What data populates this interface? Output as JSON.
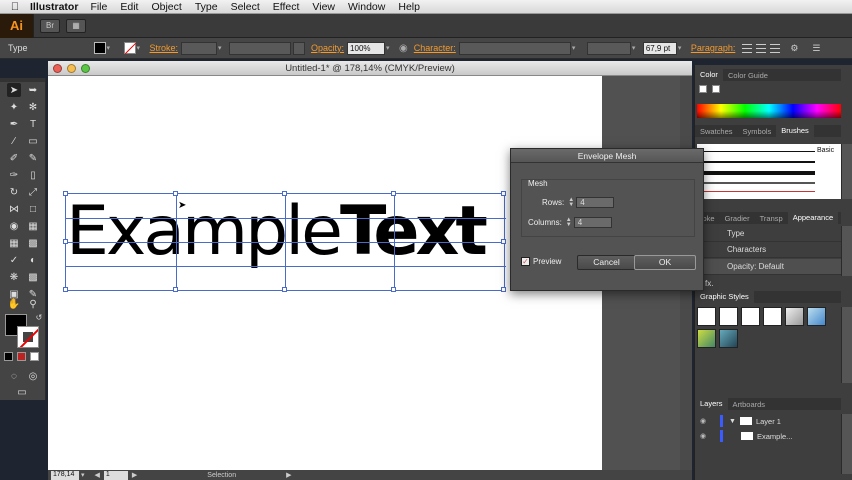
{
  "menubar": {
    "app_name": "Illustrator",
    "items": [
      "File",
      "Edit",
      "Object",
      "Type",
      "Select",
      "Effect",
      "View",
      "Window",
      "Help"
    ]
  },
  "appbar": {
    "logo": "Ai"
  },
  "control_bar": {
    "type_label": "Type",
    "stroke_label": "Stroke:",
    "opacity_label": "Opacity:",
    "opacity_value": "100%",
    "character_label": "Character:",
    "font_size_value": "67,9 pt",
    "paragraph_label": "Paragraph:"
  },
  "document": {
    "title": "Untitled-1* @ 178,14% (CMYK/Preview)",
    "example_word_1": "Example",
    "example_word_2": "Text"
  },
  "status_bar": {
    "zoom": "178,14",
    "artboard": "1",
    "tool": "Selection"
  },
  "panels": {
    "color_tabs": [
      "Color",
      "Color Guide"
    ],
    "swatch_tabs": [
      "Swatches",
      "Symbols",
      "Brushes"
    ],
    "brush_label": "Basic",
    "appearance_tabs": [
      "roke",
      "Gradier",
      "Transp",
      "Appearance"
    ],
    "appearance_rows": [
      "Type",
      "Characters",
      "Opacity: Default"
    ],
    "fx_label": "fx.",
    "graphic_styles_tab": "Graphic Styles",
    "layers_tabs": [
      "Layers",
      "Artboards"
    ],
    "layers": [
      "Layer 1",
      "Example..."
    ]
  },
  "dialog": {
    "title": "Envelope Mesh",
    "group_label": "Mesh",
    "rows_label": "Rows:",
    "rows_value": "4",
    "columns_label": "Columns:",
    "columns_value": "4",
    "preview_label": "Preview",
    "cancel_label": "Cancel",
    "ok_label": "OK"
  },
  "colors": {
    "accent": "#f29a2e",
    "mesh": "#4a6bc8"
  }
}
